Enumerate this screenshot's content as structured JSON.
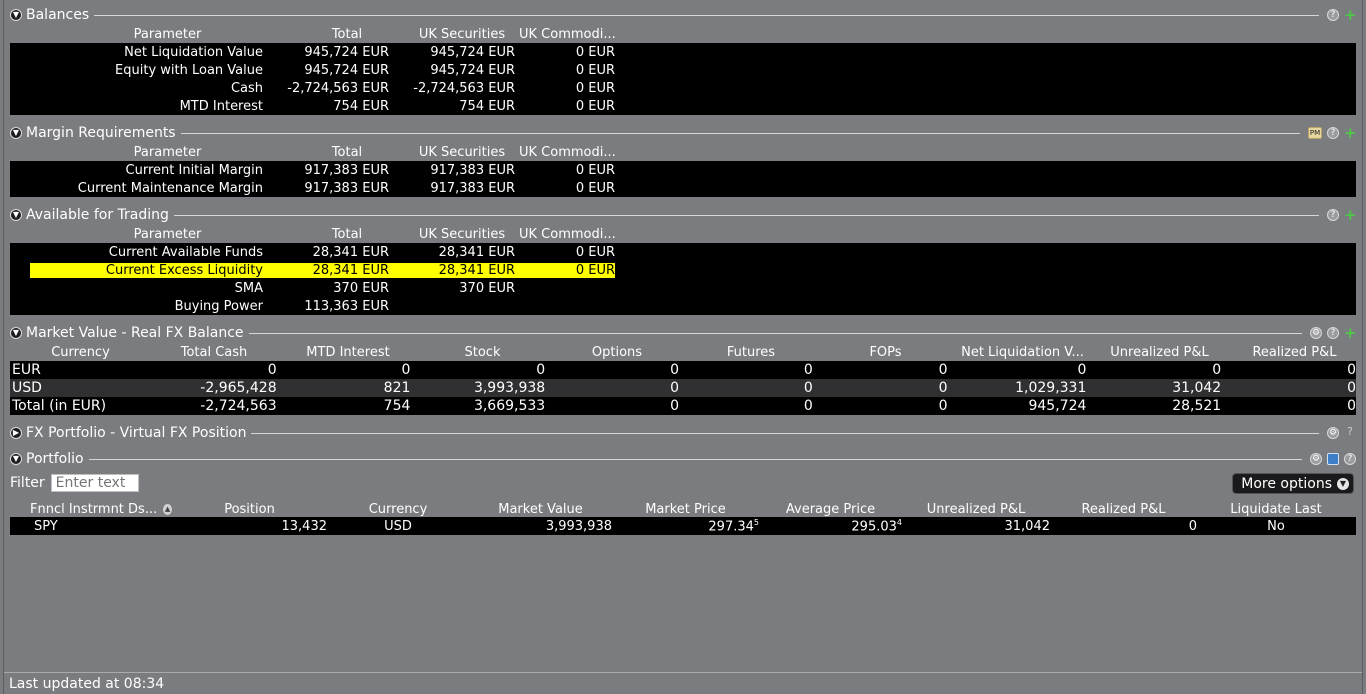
{
  "balances": {
    "title": "Balances",
    "headers": [
      "Parameter",
      "Total",
      "UK Securities",
      "UK Commodi..."
    ],
    "rows": [
      {
        "param": "Net Liquidation Value",
        "total": "945,724 EUR",
        "uks": "945,724 EUR",
        "ukc": "0 EUR"
      },
      {
        "param": "Equity with Loan Value",
        "total": "945,724 EUR",
        "uks": "945,724 EUR",
        "ukc": "0 EUR"
      },
      {
        "param": "Cash",
        "total": "-2,724,563 EUR",
        "uks": "-2,724,563 EUR",
        "ukc": "0 EUR"
      },
      {
        "param": "MTD Interest",
        "total": "754 EUR",
        "uks": "754 EUR",
        "ukc": "0 EUR"
      }
    ]
  },
  "margin": {
    "title": "Margin Requirements",
    "headers": [
      "Parameter",
      "Total",
      "UK Securities",
      "UK Commodi..."
    ],
    "rows": [
      {
        "param": "Current Initial Margin",
        "total": "917,383 EUR",
        "uks": "917,383 EUR",
        "ukc": "0 EUR"
      },
      {
        "param": "Current Maintenance Margin",
        "total": "917,383 EUR",
        "uks": "917,383 EUR",
        "ukc": "0 EUR"
      }
    ]
  },
  "available": {
    "title": "Available for Trading",
    "headers": [
      "Parameter",
      "Total",
      "UK Securities",
      "UK Commodi..."
    ],
    "rows": [
      {
        "param": "Current Available Funds",
        "total": "28,341 EUR",
        "uks": "28,341 EUR",
        "ukc": "0 EUR"
      },
      {
        "param": "Current Excess Liquidity",
        "total": "28,341 EUR",
        "uks": "28,341 EUR",
        "ukc": "0 EUR"
      },
      {
        "param": "SMA",
        "total": "370 EUR",
        "uks": "370 EUR",
        "ukc": ""
      },
      {
        "param": "Buying Power",
        "total": "113,363 EUR",
        "uks": "",
        "ukc": ""
      }
    ],
    "highlight_color": "#ffff00"
  },
  "market_value": {
    "title": "Market Value - Real FX Balance",
    "headers": [
      "Currency",
      "Total Cash",
      "MTD Interest",
      "Stock",
      "Options",
      "Futures",
      "FOPs",
      "Net Liquidation V...",
      "Unrealized P&L",
      "Realized P&L"
    ],
    "rows": [
      [
        "EUR",
        "0",
        "0",
        "0",
        "0",
        "0",
        "0",
        "0",
        "0",
        "0"
      ],
      [
        "USD",
        "-2,965,428",
        "821",
        "3,993,938",
        "0",
        "0",
        "0",
        "1,029,331",
        "31,042",
        "0"
      ],
      [
        "Total (in EUR)",
        "-2,724,563",
        "754",
        "3,669,533",
        "0",
        "0",
        "0",
        "945,724",
        "28,521",
        "0"
      ]
    ]
  },
  "fx_portfolio": {
    "title": "FX Portfolio - Virtual FX Position"
  },
  "portfolio": {
    "title": "Portfolio",
    "filter_label": "Filter",
    "filter_placeholder": "Enter text",
    "more_options": "More options",
    "headers": [
      "Fnncl Instrmnt Ds...",
      "Position",
      "Currency",
      "Market Value",
      "Market Price",
      "Average Price",
      "Unrealized P&L",
      "Realized P&L",
      "Liquidate Last"
    ],
    "rows": [
      {
        "instrument": "SPY",
        "position": "13,432",
        "currency": "USD",
        "market_value": "3,993,938",
        "market_price": "297.34",
        "market_price_sup": "5",
        "avg_price": "295.03",
        "avg_price_sup": "4",
        "unrealized": "31,042",
        "realized": "0",
        "liquidate_last": "No"
      }
    ]
  },
  "footer": {
    "last_updated": "Last updated at 08:34"
  },
  "icons": [
    "collapse-icon",
    "expand-icon",
    "help-icon",
    "add-icon",
    "pin-icon",
    "settings-icon",
    "window-icon",
    "sort-icon",
    "dropdown-icon"
  ],
  "colors": {
    "background": "#7b7c80",
    "table_bg": "#000000",
    "highlight": "#ffff00",
    "add_green": "#4fc84a"
  }
}
